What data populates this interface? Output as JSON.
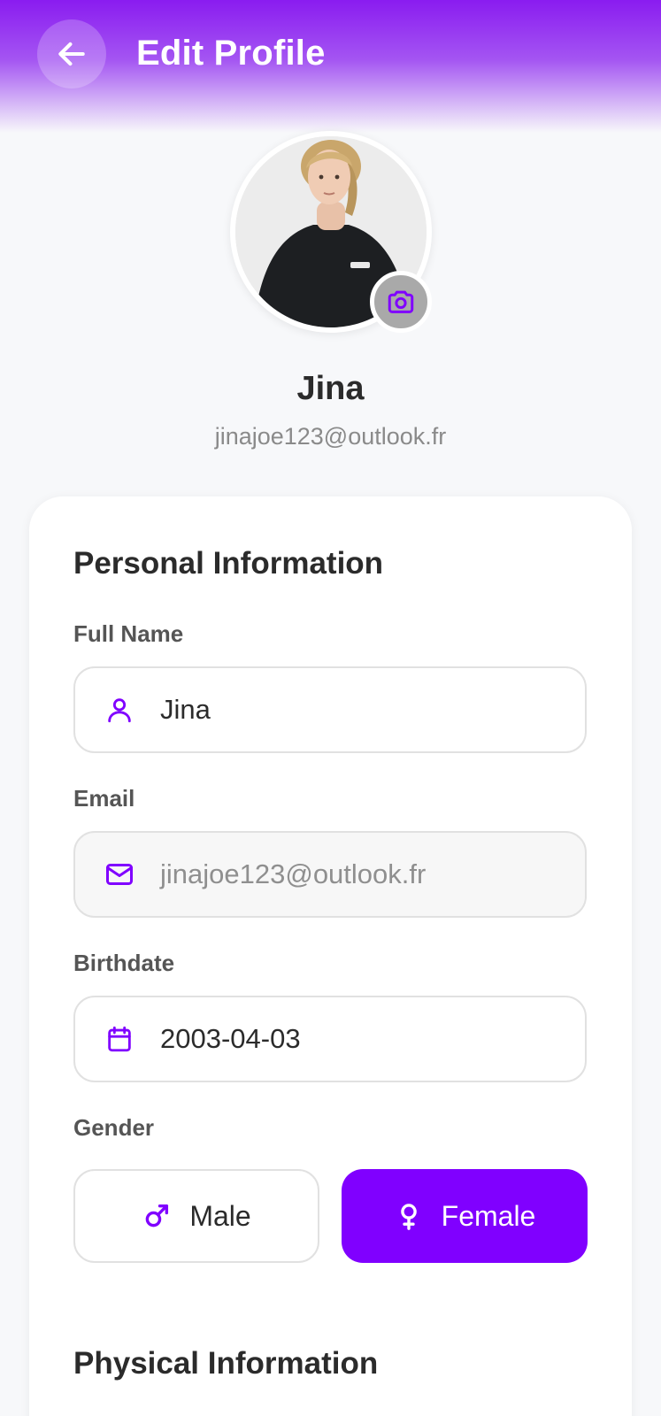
{
  "header": {
    "title": "Edit Profile",
    "back_icon": "arrow-left-icon"
  },
  "profile": {
    "name": "Jina",
    "email": "jinajoe123@outlook.fr",
    "camera_icon": "camera-icon"
  },
  "personal": {
    "section_title": "Personal Information",
    "full_name": {
      "label": "Full Name",
      "value": "Jina",
      "icon": "user-icon"
    },
    "email": {
      "label": "Email",
      "value": "jinajoe123@outlook.fr",
      "icon": "mail-icon"
    },
    "birthdate": {
      "label": "Birthdate",
      "value": "2003-04-03",
      "icon": "calendar-icon"
    },
    "gender": {
      "label": "Gender",
      "options": [
        {
          "label": "Male",
          "icon": "male-icon",
          "selected": false
        },
        {
          "label": "Female",
          "icon": "female-icon",
          "selected": true
        }
      ]
    }
  },
  "physical": {
    "section_title": "Physical Information"
  },
  "colors": {
    "accent": "#8000ff",
    "header_gradient_start": "#8a1cf0",
    "background": "#f7f8fa"
  }
}
